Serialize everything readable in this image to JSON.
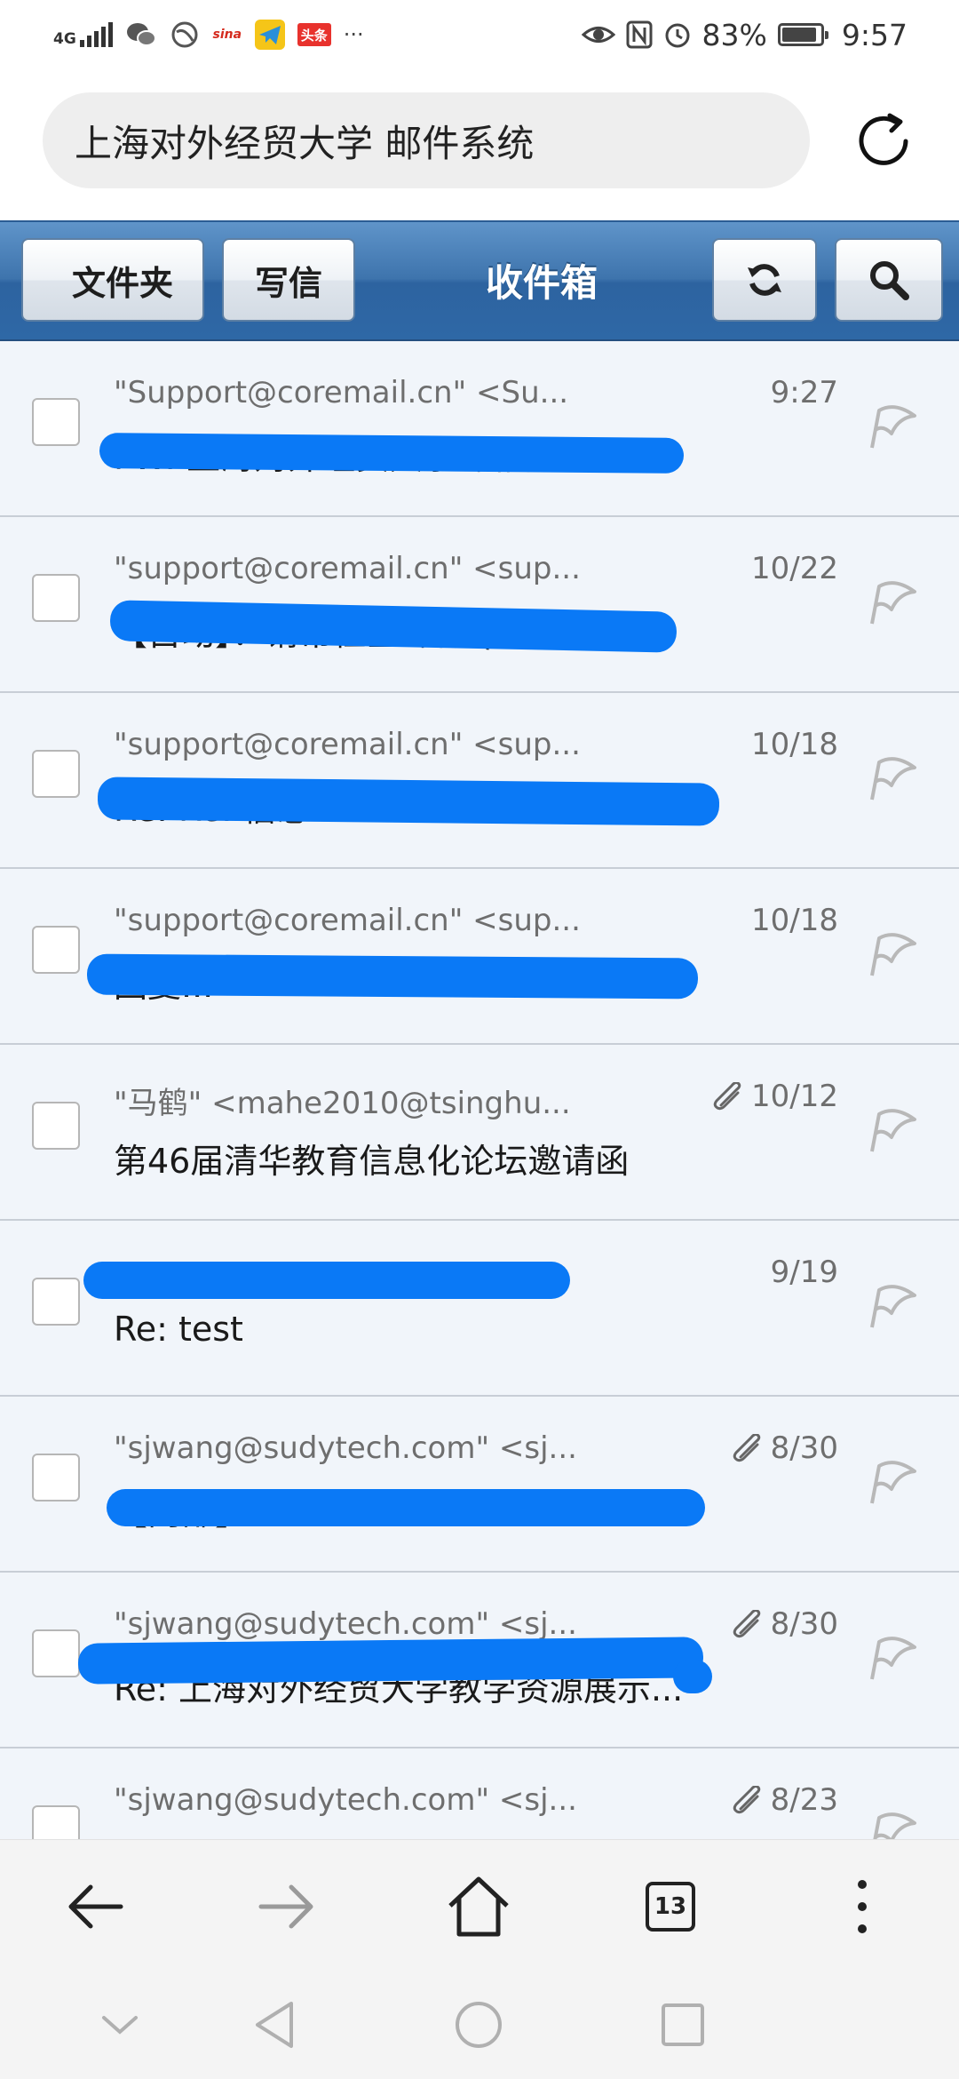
{
  "status_bar": {
    "network_type": "4G",
    "app_badge_weibo": "sina",
    "app_badge_toutiao": "头条",
    "more": "···",
    "battery_percent": "83%",
    "battery_level": 0.83,
    "time": "9:57"
  },
  "address_bar": {
    "page_title": "上海对外经贸大学 邮件系统"
  },
  "mail_header": {
    "back_label": "文件夹",
    "compose_label": "写信",
    "title": "收件箱",
    "refresh_icon": "refresh-icon",
    "search_icon": "search-icon"
  },
  "emails": [
    {
      "sender": "\"Support@coremail.cn\" <Su...",
      "date": "9:27",
      "subject": "FW: 上海对外经贸大学邮箱问题（...",
      "attachment": false
    },
    {
      "sender": "\"support@coremail.cn\" <sup...",
      "date": "10/22",
      "subject": "【自动】：请帮检查邮件 (...",
      "attachment": false
    },
    {
      "sender": "\"support@coremail.cn\" <sup...",
      "date": "10/18",
      "subject": "Re: Re: 信息...",
      "attachment": false
    },
    {
      "sender": "\"support@coremail.cn\" <sup...",
      "date": "10/18",
      "subject": "回复...",
      "attachment": false
    },
    {
      "sender": "\"马鹤\" <mahe2010@tsinghu...",
      "date": "10/12",
      "subject": "第46届清华教育信息化论坛邀请函",
      "attachment": true
    },
    {
      "sender": "",
      "date": "9/19",
      "subject": "Re: test",
      "attachment": false
    },
    {
      "sender": "\"sjwang@sudytech.com\" <sj...",
      "date": "8/30",
      "subject": "【内部】...",
      "attachment": true
    },
    {
      "sender": "\"sjwang@sudytech.com\" <sj...",
      "date": "8/30",
      "subject": "Re: 上海对外经贸大学教学资源展示...",
      "attachment": true
    },
    {
      "sender": "\"sjwang@sudytech.com\" <sj...",
      "date": "8/23",
      "subject": "",
      "attachment": true
    }
  ],
  "browser_nav": {
    "tab_count": "13",
    "icons": [
      "back-arrow-icon",
      "forward-arrow-icon",
      "home-icon",
      "tabs-icon",
      "more-vertical-icon"
    ]
  },
  "system_nav": {
    "icons": [
      "collapse-icon",
      "back-triangle-icon",
      "home-circle-icon",
      "recents-square-icon"
    ]
  },
  "colors": {
    "header_blue": "#3e74ad",
    "redaction_blue": "#0a79f6",
    "list_background": "#f1f5fa"
  }
}
